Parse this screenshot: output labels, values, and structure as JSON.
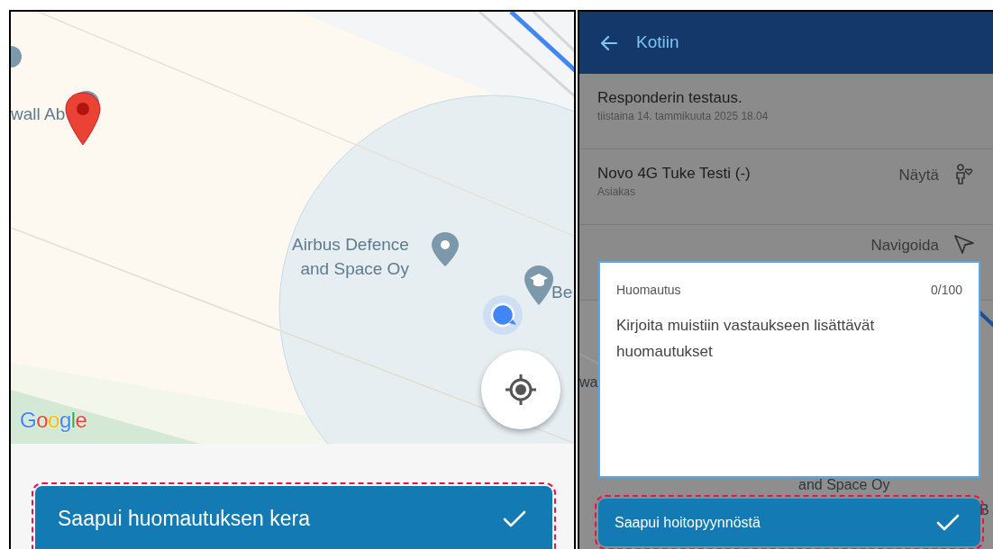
{
  "left_screen": {
    "map": {
      "labels": [
        {
          "kind": "poi",
          "text": "wall Ab"
        },
        {
          "kind": "poi",
          "text": "Airbus Defence\nand Space Oy"
        },
        {
          "kind": "poi",
          "text": "Be"
        }
      ],
      "logo": "Google"
    },
    "action_button": {
      "label": "Saapui huomautuksen kera",
      "highlighted": true
    }
  },
  "right_screen": {
    "header": {
      "title": "Kotiin"
    },
    "rows": [
      {
        "title": "Responderin testaus.",
        "subtitle": "tiistaina 14. tammikuuta 2025 18.04"
      },
      {
        "title": "Novo 4G  Tuke Testi (-)",
        "subtitle": "Asiakas",
        "action": "Näytä",
        "kind": "person"
      },
      {
        "action": "Navigoida",
        "kind": "navigate"
      }
    ],
    "map_labels": [
      "wa",
      "and Space Oy",
      "B"
    ],
    "dialog": {
      "label": "Huomautus",
      "counter": "0/100",
      "placeholder": "Kirjoita muistiin vastaukseen lisättävät huomautukset"
    },
    "action_button": {
      "label": "Saapui hoitopyynnöstä",
      "highlighted": true
    }
  }
}
